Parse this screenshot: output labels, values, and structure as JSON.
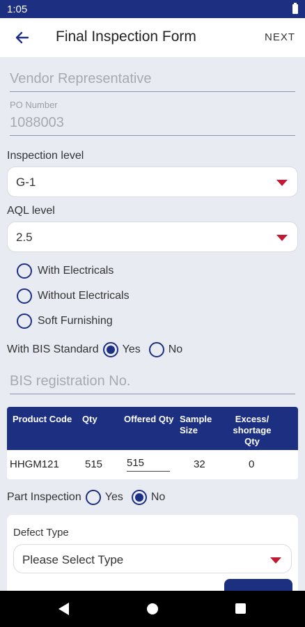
{
  "status_bar": {
    "time": "1:05"
  },
  "app_bar": {
    "title": "Final Inspection Form",
    "next_label": "NEXT"
  },
  "form": {
    "vendor_representative": {
      "placeholder": "Vendor Representative"
    },
    "po_number": {
      "label": "PO Number",
      "value": "1088003"
    },
    "inspection_level": {
      "label": "Inspection level",
      "value": "G-1"
    },
    "aql_level": {
      "label": "AQL level",
      "value": "2.5"
    },
    "electrical_options": [
      {
        "label": "With Electricals",
        "selected": false
      },
      {
        "label": "Without Electricals",
        "selected": false
      },
      {
        "label": "Soft Furnishing",
        "selected": false
      }
    ],
    "bis_standard": {
      "label": "With BIS Standard",
      "yes": "Yes",
      "no": "No",
      "selected": "Yes"
    },
    "bis_registration": {
      "placeholder": "BIS registration No."
    },
    "table": {
      "headers": [
        "Product Code",
        "Qty",
        "Offered Qty",
        "Sample Size",
        "Excess/ shortage Qty"
      ],
      "rows": [
        {
          "product_code": "HHGM121",
          "qty": "515",
          "offered_qty": "515",
          "sample_size": "32",
          "excess_shortage": "0"
        }
      ]
    },
    "part_inspection": {
      "label": "Part Inspection",
      "yes": "Yes",
      "no": "No",
      "selected": "No"
    },
    "defect": {
      "label": "Defect Type",
      "placeholder": "Please Select Type"
    }
  },
  "colors": {
    "primary": "#1d2f80",
    "accent": "#c01a35",
    "background": "#e8ebf2"
  }
}
